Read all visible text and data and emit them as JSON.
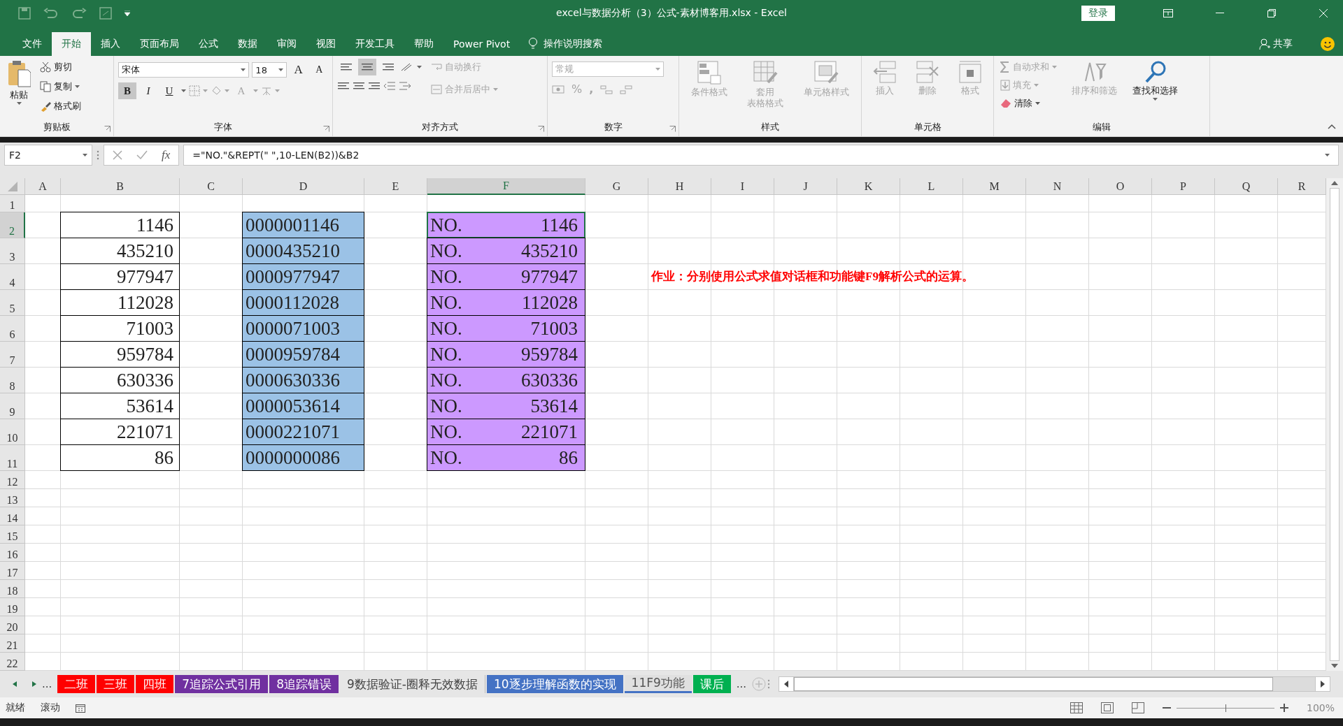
{
  "window": {
    "title": "excel与数据分析（3）公式-素材博客用.xlsx  -  Excel",
    "login": "登录"
  },
  "menu": {
    "tabs": [
      {
        "label": "文件",
        "selected": false
      },
      {
        "label": "开始",
        "selected": true
      },
      {
        "label": "插入",
        "selected": false
      },
      {
        "label": "页面布局",
        "selected": false
      },
      {
        "label": "公式",
        "selected": false
      },
      {
        "label": "数据",
        "selected": false
      },
      {
        "label": "审阅",
        "selected": false
      },
      {
        "label": "视图",
        "selected": false
      },
      {
        "label": "开发工具",
        "selected": false
      },
      {
        "label": "帮助",
        "selected": false
      },
      {
        "label": "Power Pivot",
        "selected": false
      }
    ],
    "search": "操作说明搜索",
    "share": "共享"
  },
  "ribbon": {
    "clipboard": {
      "label": "剪贴板",
      "paste": "粘贴",
      "cut": "剪切",
      "copy": "复制",
      "format_painter": "格式刷"
    },
    "font": {
      "label": "字体",
      "font_name": "宋体",
      "font_size": "18",
      "grow": "A",
      "shrink": "A",
      "font_color": "A",
      "styles": [
        {
          "label": "B",
          "selected": true
        },
        {
          "label": "I",
          "selected": false
        },
        {
          "label": "U",
          "selected": false
        }
      ]
    },
    "alignment": {
      "label": "对齐方式",
      "vertical": [
        {
          "selected": false
        },
        {
          "selected": true
        },
        {
          "selected": false
        }
      ],
      "wrap": {
        "label": "自动换行",
        "disabled": true
      },
      "merge": {
        "label": "合并后居中",
        "disabled": true
      }
    },
    "number": {
      "label": "数字",
      "format": "常规",
      "percent": "%",
      "comma": ","
    },
    "styles": {
      "label": "样式",
      "items": [
        {
          "lines": [
            "条件格式"
          ],
          "disabled": true
        },
        {
          "lines": [
            "套用",
            "表格格式"
          ],
          "disabled": true
        },
        {
          "lines": [
            "单元格样式"
          ],
          "disabled": true
        }
      ]
    },
    "cells": {
      "label": "单元格",
      "items": [
        {
          "label": "插入",
          "disabled": true
        },
        {
          "label": "删除",
          "disabled": true
        },
        {
          "label": "格式",
          "disabled": true
        }
      ]
    },
    "editing": {
      "label": "编辑",
      "items": [
        {
          "label": "自动求和",
          "disabled": true
        },
        {
          "label": "填充",
          "disabled": true
        },
        {
          "label": "清除",
          "disabled": false
        }
      ],
      "sort": {
        "label": "排序和筛选",
        "disabled": true
      },
      "find": {
        "label": "查找和选择",
        "disabled": false
      }
    }
  },
  "formula_bar": {
    "name_box": "F2",
    "fx": "fx",
    "formula": "=\"NO.\"&REPT(\" \",10-LEN(B2))&B2"
  },
  "sheet": {
    "columns": [
      {
        "label": "A",
        "selected": false
      },
      {
        "label": "B",
        "selected": false
      },
      {
        "label": "C",
        "selected": false
      },
      {
        "label": "D",
        "selected": false
      },
      {
        "label": "E",
        "selected": false
      },
      {
        "label": "F",
        "selected": true
      },
      {
        "label": "G",
        "selected": false
      },
      {
        "label": "H",
        "selected": false
      },
      {
        "label": "I",
        "selected": false
      },
      {
        "label": "J",
        "selected": false
      },
      {
        "label": "K",
        "selected": false
      },
      {
        "label": "L",
        "selected": false
      },
      {
        "label": "M",
        "selected": false
      },
      {
        "label": "N",
        "selected": false
      },
      {
        "label": "O",
        "selected": false
      },
      {
        "label": "P",
        "selected": false
      },
      {
        "label": "Q",
        "selected": false
      },
      {
        "label": "R",
        "selected": false
      }
    ],
    "rows": [
      {
        "label": "1",
        "selected": false
      },
      {
        "label": "2",
        "selected": true
      },
      {
        "label": "3",
        "selected": false
      },
      {
        "label": "4",
        "selected": false
      },
      {
        "label": "5",
        "selected": false
      },
      {
        "label": "6",
        "selected": false
      },
      {
        "label": "7",
        "selected": false
      },
      {
        "label": "8",
        "selected": false
      },
      {
        "label": "9",
        "selected": false
      },
      {
        "label": "10",
        "selected": false
      },
      {
        "label": "11",
        "selected": false
      },
      {
        "label": "12",
        "selected": false
      },
      {
        "label": "13",
        "selected": false
      },
      {
        "label": "14",
        "selected": false
      },
      {
        "label": "15",
        "selected": false
      },
      {
        "label": "16",
        "selected": false
      },
      {
        "label": "17",
        "selected": false
      },
      {
        "label": "18",
        "selected": false
      },
      {
        "label": "19",
        "selected": false
      },
      {
        "label": "20",
        "selected": false
      },
      {
        "label": "21",
        "selected": false
      },
      {
        "label": "22",
        "selected": false
      }
    ],
    "data": [
      {
        "b": "1146",
        "d": "0000001146",
        "f_label": "NO.",
        "f_value": "1146"
      },
      {
        "b": "435210",
        "d": "0000435210",
        "f_label": "NO.",
        "f_value": "435210"
      },
      {
        "b": "977947",
        "d": "0000977947",
        "f_label": "NO.",
        "f_value": "977947"
      },
      {
        "b": "112028",
        "d": "0000112028",
        "f_label": "NO.",
        "f_value": "112028"
      },
      {
        "b": "71003",
        "d": "0000071003",
        "f_label": "NO.",
        "f_value": "71003"
      },
      {
        "b": "959784",
        "d": "0000959784",
        "f_label": "NO.",
        "f_value": "959784"
      },
      {
        "b": "630336",
        "d": "0000630336",
        "f_label": "NO.",
        "f_value": "630336"
      },
      {
        "b": "53614",
        "d": "0000053614",
        "f_label": "NO.",
        "f_value": "53614"
      },
      {
        "b": "221071",
        "d": "0000221071",
        "f_label": "NO.",
        "f_value": "221071"
      },
      {
        "b": "86",
        "d": "0000000086",
        "f_label": "NO.",
        "f_value": "86"
      }
    ],
    "note": "作业：分别使用公式求值对话框和功能键F9解析公式的运算。"
  },
  "sheet_tabs": {
    "more_left": "...",
    "more_right": "...",
    "tabs": [
      {
        "label": "二班",
        "color": "#ff0000",
        "selected": false
      },
      {
        "label": "三班",
        "color": "#ff0000",
        "selected": false
      },
      {
        "label": "四班",
        "color": "#ff0000",
        "selected": false
      },
      {
        "label": "7追踪公式引用",
        "color": "#7030a0",
        "selected": false
      },
      {
        "label": "8追踪错误",
        "color": "#7030a0",
        "selected": false
      },
      {
        "label": "9数据验证-圈释无效数据",
        "selected": false
      },
      {
        "label": "10逐步理解函数的实现",
        "color": "#4472c4",
        "selected": false
      },
      {
        "label": "11F9功能",
        "color": "#4472c4",
        "selected": true
      },
      {
        "label": "课后",
        "color": "#00b050",
        "selected": false
      }
    ]
  },
  "status_bar": {
    "ready": "就绪",
    "scroll": "滚动",
    "zoom": "100%",
    "zoom_slider": {
      "level": 0.5
    }
  }
}
